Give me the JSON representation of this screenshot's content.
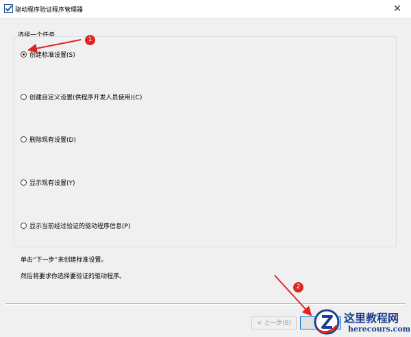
{
  "window": {
    "title": "驱动程序验证程序管理器",
    "close_glyph": "✕"
  },
  "task_section": {
    "label": "选择一个任务",
    "options": [
      {
        "label": "创建标准设置(S)",
        "checked": true
      },
      {
        "label": "创建自定义设置(供程序开发人员使用)(C)",
        "checked": false
      },
      {
        "label": "删除现有设置(D)",
        "checked": false
      },
      {
        "label": "显示现有设置(Y)",
        "checked": false
      },
      {
        "label": "显示当前经过验证的驱动程序信息(P)",
        "checked": false
      }
    ]
  },
  "hints": {
    "line1": "单击“下一步”来创建标准设置。",
    "line2": "然后将要求你选择要验证的驱动程序。"
  },
  "buttons": {
    "back_label": "< 上一步(B)",
    "next_label": "下"
  },
  "annotations": {
    "badge1": "1",
    "badge2": "2",
    "color": "#e02424"
  },
  "watermark": {
    "title": "这里教程网",
    "url": "herecours.com"
  }
}
